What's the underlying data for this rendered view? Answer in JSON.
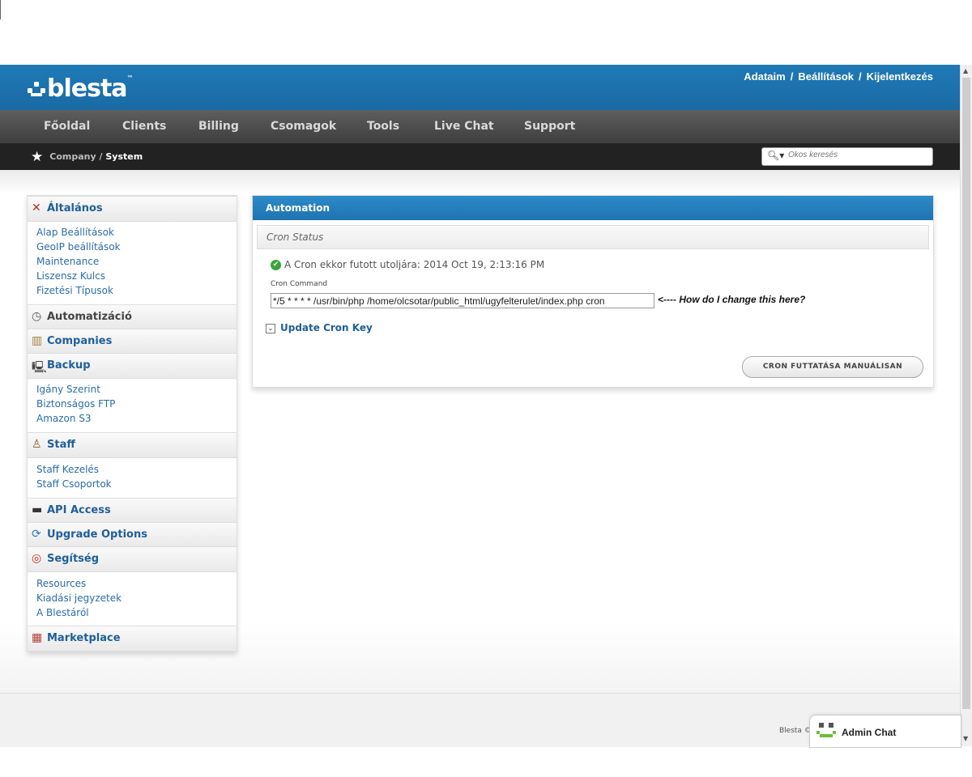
{
  "header": {
    "logo": "blesta",
    "logo_tm": "™",
    "links": [
      "Adataim",
      "Beállítások",
      "Kijelentkezés"
    ],
    "link_separator": "/"
  },
  "nav": {
    "items": [
      "Főoldal",
      "Clients",
      "Billing",
      "Csomagok",
      "Tools",
      "Live Chat",
      "Support"
    ]
  },
  "breadcrumb": {
    "parent": "Company",
    "separator": "/",
    "current": "System"
  },
  "search": {
    "placeholder": "Okos keresés"
  },
  "sidebar": {
    "sections": [
      {
        "label": "Általános",
        "icon": "tools-icon",
        "links": [
          "Alap Beállítások",
          "GeoIP beállítások",
          "Maintenance",
          "Liszensz Kulcs",
          "Fizetési Típusok"
        ]
      },
      {
        "label": "Automatizáció",
        "icon": "clock-icon",
        "links": []
      },
      {
        "label": "Companies",
        "icon": "building-icon",
        "links": []
      },
      {
        "label": "Backup",
        "icon": "computer-icon",
        "links": [
          "Igány Szerint",
          "Biztonságos FTP",
          "Amazon S3"
        ]
      },
      {
        "label": "Staff",
        "icon": "user-icon",
        "links": [
          "Staff Kezelés",
          "Staff Csoportok"
        ]
      },
      {
        "label": "API Access",
        "icon": "terminal-icon",
        "links": []
      },
      {
        "label": "Upgrade Options",
        "icon": "refresh-icon",
        "links": []
      },
      {
        "label": "Segítség",
        "icon": "lifebuoy-icon",
        "links": [
          "Resources",
          "Kiadási jegyzetek",
          "A Blestáról"
        ]
      },
      {
        "label": "Marketplace",
        "icon": "basket-icon",
        "links": []
      }
    ]
  },
  "panel": {
    "title": "Automation",
    "subheading": "Cron Status",
    "status_text": "A Cron ekkor futott utoljára: 2014 Oct 19, 2:13:16 PM",
    "cron_command_label": "Cron Command",
    "cron_command_value": "*/5 * * * * /usr/bin/php /home/olcsotar/public_html/ugyfelterulet/index.php cron",
    "annotation": "<---- How do I change this here?",
    "update_key_label": "Update Cron Key",
    "run_button_label": "CRON FUTTATÁSA MANUÁLISAN"
  },
  "footer": {
    "copyright": "Blesta ©"
  },
  "chat": {
    "label": "Admin Chat"
  }
}
